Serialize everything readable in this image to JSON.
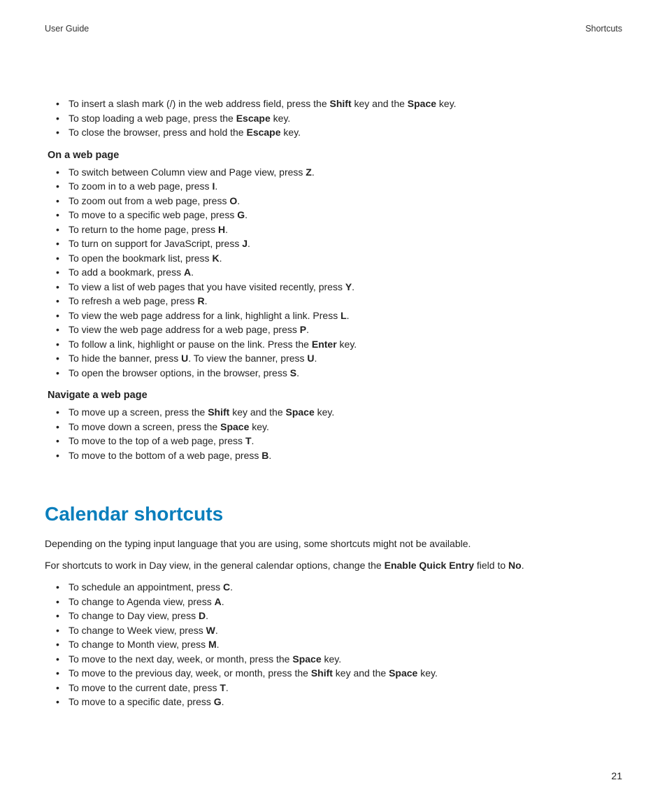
{
  "header": {
    "left": "User Guide",
    "right": "Shortcuts"
  },
  "intro_list": [
    [
      [
        "To insert a slash mark (/) in the web address field, press the "
      ],
      [
        "b",
        "Shift"
      ],
      [
        " key and the "
      ],
      [
        "b",
        "Space"
      ],
      [
        " key."
      ]
    ],
    [
      [
        "To stop loading a web page, press the "
      ],
      [
        "b",
        "Escape"
      ],
      [
        " key."
      ]
    ],
    [
      [
        "To close the browser, press and hold the "
      ],
      [
        "b",
        "Escape"
      ],
      [
        " key."
      ]
    ]
  ],
  "sub1": "On a web page",
  "list1": [
    [
      [
        "To switch between Column view and Page view, press "
      ],
      [
        "b",
        "Z"
      ],
      [
        ". "
      ]
    ],
    [
      [
        "To zoom in to a web page, press "
      ],
      [
        "b",
        "I"
      ],
      [
        ". "
      ]
    ],
    [
      [
        "To zoom out from a web page, press "
      ],
      [
        "b",
        "O"
      ],
      [
        ". "
      ]
    ],
    [
      [
        "To move to a specific web page, press "
      ],
      [
        "b",
        "G"
      ],
      [
        ". "
      ]
    ],
    [
      [
        "To return to the home page, press "
      ],
      [
        "b",
        "H"
      ],
      [
        ". "
      ]
    ],
    [
      [
        "To turn on support for JavaScript, press "
      ],
      [
        "b",
        "J"
      ],
      [
        ". "
      ]
    ],
    [
      [
        "To open the bookmark list, press "
      ],
      [
        "b",
        "K"
      ],
      [
        ". "
      ]
    ],
    [
      [
        "To add a bookmark, press "
      ],
      [
        "b",
        "A"
      ],
      [
        ". "
      ]
    ],
    [
      [
        "To view a list of web pages that you have visited recently, press "
      ],
      [
        "b",
        "Y"
      ],
      [
        ". "
      ]
    ],
    [
      [
        "To refresh a web page, press "
      ],
      [
        "b",
        "R"
      ],
      [
        ". "
      ]
    ],
    [
      [
        "To view the web page address for a link, highlight a link. Press "
      ],
      [
        "b",
        "L"
      ],
      [
        ". "
      ]
    ],
    [
      [
        "To view the web page address for a web page, press "
      ],
      [
        "b",
        "P"
      ],
      [
        ". "
      ]
    ],
    [
      [
        "To follow a link, highlight or pause on the link. Press the "
      ],
      [
        "b",
        "Enter"
      ],
      [
        " key."
      ]
    ],
    [
      [
        "To hide the banner, press "
      ],
      [
        "b",
        "U"
      ],
      [
        ". To view the banner, press "
      ],
      [
        "b",
        "U"
      ],
      [
        ". "
      ]
    ],
    [
      [
        "To open the browser options, in the browser, press "
      ],
      [
        "b",
        "S"
      ],
      [
        ". "
      ]
    ]
  ],
  "sub2": "Navigate a web page",
  "list2": [
    [
      [
        "To move up a screen, press the "
      ],
      [
        "b",
        "Shift"
      ],
      [
        " key and the "
      ],
      [
        "b",
        "Space"
      ],
      [
        " key."
      ]
    ],
    [
      [
        "To move down a screen, press the "
      ],
      [
        "b",
        "Space"
      ],
      [
        " key."
      ]
    ],
    [
      [
        "To move to the top of a web page, press "
      ],
      [
        "b",
        "T"
      ],
      [
        ". "
      ]
    ],
    [
      [
        "To move to the bottom of a web page, press "
      ],
      [
        "b",
        "B"
      ],
      [
        ". "
      ]
    ]
  ],
  "section_heading": "Calendar shortcuts",
  "para1": [
    [
      "Depending on the typing input language that you are using, some shortcuts might not be available."
    ]
  ],
  "para2": [
    [
      "For shortcuts to work in Day view, in the general calendar options, change the "
    ],
    [
      "b",
      "Enable Quick Entry"
    ],
    [
      " field to "
    ],
    [
      "b",
      "No"
    ],
    [
      ". "
    ]
  ],
  "list3": [
    [
      [
        "To schedule an appointment, press "
      ],
      [
        "b",
        "C"
      ],
      [
        ". "
      ]
    ],
    [
      [
        "To change to Agenda view, press "
      ],
      [
        "b",
        "A"
      ],
      [
        ". "
      ]
    ],
    [
      [
        "To change to Day view, press "
      ],
      [
        "b",
        "D"
      ],
      [
        ". "
      ]
    ],
    [
      [
        "To change to Week view, press "
      ],
      [
        "b",
        "W"
      ],
      [
        ". "
      ]
    ],
    [
      [
        "To change to Month view, press "
      ],
      [
        "b",
        "M"
      ],
      [
        ". "
      ]
    ],
    [
      [
        "To move to the next day, week, or month, press the "
      ],
      [
        "b",
        "Space"
      ],
      [
        " key."
      ]
    ],
    [
      [
        "To move to the previous day, week, or month, press the "
      ],
      [
        "b",
        "Shift"
      ],
      [
        " key and the "
      ],
      [
        "b",
        "Space"
      ],
      [
        " key."
      ]
    ],
    [
      [
        "To move to the current date, press "
      ],
      [
        "b",
        "T"
      ],
      [
        ". "
      ]
    ],
    [
      [
        "To move to a specific date, press "
      ],
      [
        "b",
        "G"
      ],
      [
        ". "
      ]
    ]
  ],
  "page_number": "21"
}
